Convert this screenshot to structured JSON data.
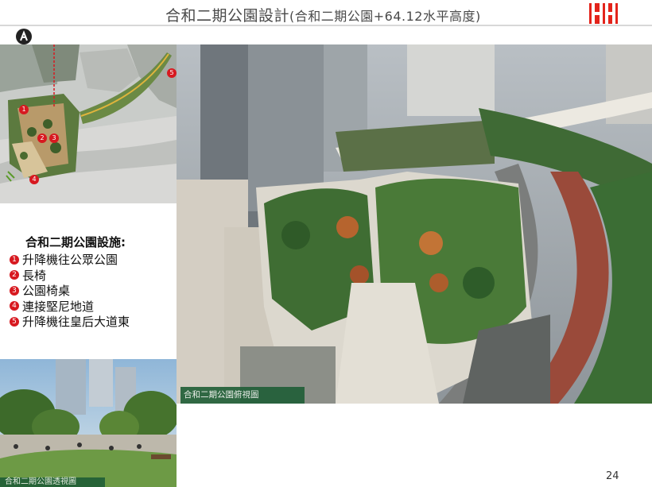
{
  "header": {
    "title": "合和二期公園設計",
    "subtitle": "(合和二期公園+64.12水平高度)",
    "logo_icon": "hh-logo-icon",
    "brand_color": "#e3241b"
  },
  "site_plan": {
    "north_icon": "north-arrow-icon",
    "markers": [
      "1",
      "2",
      "3",
      "4",
      "5"
    ],
    "marker_color": "#d71920"
  },
  "facilities": {
    "heading": "合和二期公園設施:",
    "items": [
      {
        "num": "1",
        "label": "升降機往公眾公園"
      },
      {
        "num": "2",
        "label": "長椅"
      },
      {
        "num": "3",
        "label": "公園椅桌"
      },
      {
        "num": "4",
        "label": "連接堅尼地道"
      },
      {
        "num": "5",
        "label": "升降機往皇后大道東"
      }
    ]
  },
  "images": {
    "aerial_caption": "合和二期公園俯視圖",
    "perspective_caption": "合和二期公園透視圖",
    "caption_color": "#1f5e36"
  },
  "footer": {
    "page_number": "24"
  }
}
